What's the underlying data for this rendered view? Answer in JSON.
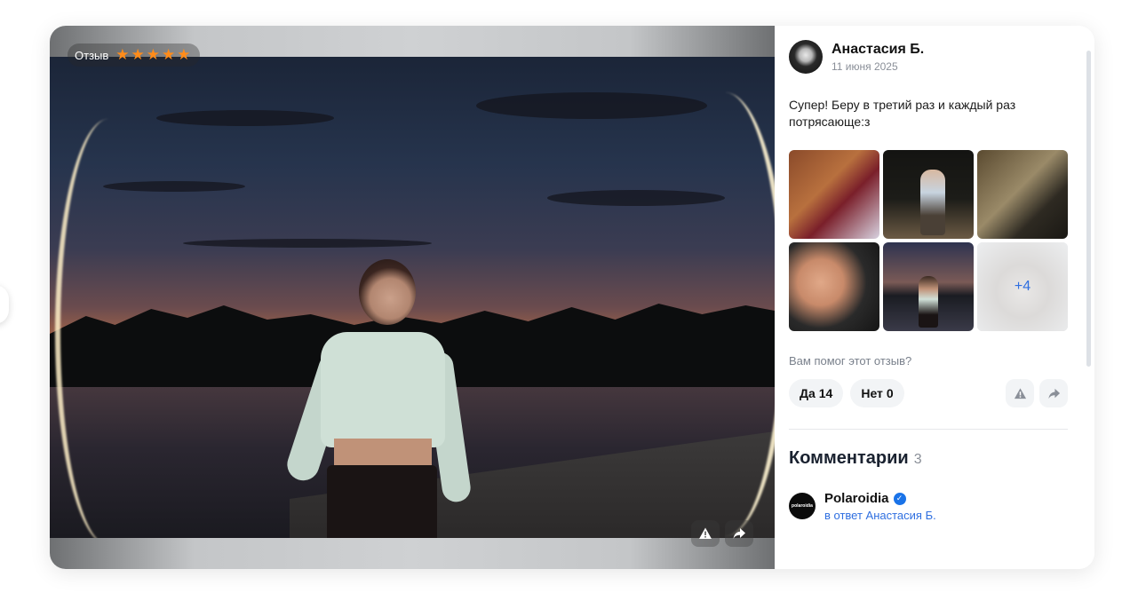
{
  "review": {
    "badge_label": "Отзыв",
    "rating": 5,
    "rating_max": 5,
    "author_name": "Анастасия Б.",
    "date": "11 июня 2025",
    "text": "Супер! Беру в третий раз и каждый раз потрясающе:з",
    "more_photos": "+4"
  },
  "helpful": {
    "question": "Вам помог этот отзыв?",
    "yes_label": "Да",
    "yes_count": "14",
    "no_label": "Нет",
    "no_count": "0"
  },
  "comments": {
    "title": "Комментарии",
    "count": "3",
    "items": [
      {
        "author": "Polaroidia",
        "avatar_text": "polaroidia",
        "reply_to": "в ответ Анастасия Б."
      }
    ]
  },
  "icons": {
    "star": "star-icon",
    "report": "warning-icon",
    "share": "share-icon",
    "verified": "verified-icon"
  },
  "colors": {
    "star": "#ff8c1a",
    "link": "#2f6fe0",
    "verified": "#1a73e8"
  }
}
